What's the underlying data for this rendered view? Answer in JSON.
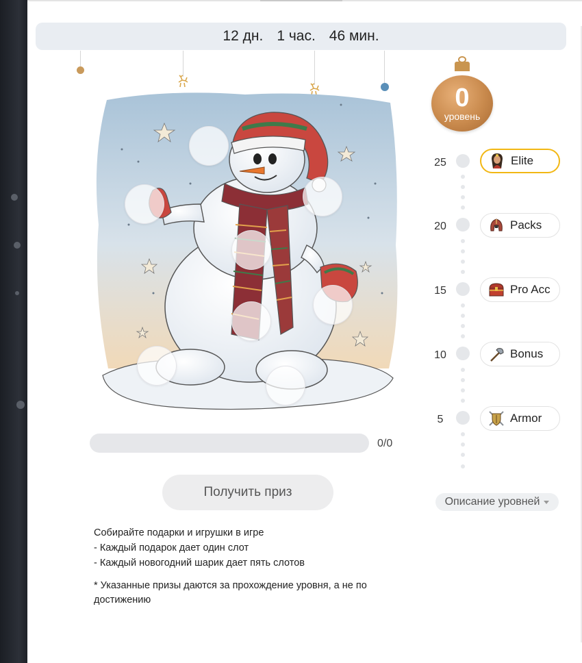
{
  "timer": {
    "days": "12 дн.",
    "hours": "1 час.",
    "minutes": "46 мин."
  },
  "level": {
    "value": "0",
    "label": "уровень"
  },
  "levels": [
    {
      "number": "25",
      "reward": "Elite",
      "icon": "elite-character-icon",
      "active": true
    },
    {
      "number": "20",
      "reward": "Packs",
      "icon": "helmet-icon",
      "active": false
    },
    {
      "number": "15",
      "reward": "Pro Acc",
      "icon": "treasure-chest-icon",
      "active": false
    },
    {
      "number": "10",
      "reward": "Bonus",
      "icon": "battle-axe-icon",
      "active": false
    },
    {
      "number": "5",
      "reward": "Armor",
      "icon": "shield-swords-icon",
      "active": false
    }
  ],
  "progress": {
    "text": "0/0",
    "fraction": 0
  },
  "claim_button": "Получить приз",
  "levels_description": "Описание уровней",
  "info": {
    "line1": "Собирайте подарки и игрушки в игре",
    "line2": "- Каждый подарок дает один слот",
    "line3": "- Каждый новогодний шарик дает пять слотов",
    "note": "* Указанные призы даются за прохождение уровня, а не по достижению"
  },
  "colors": {
    "active_border": "#f2b713",
    "badge": "#c98a4d",
    "timer_bg": "#e9edf2"
  }
}
